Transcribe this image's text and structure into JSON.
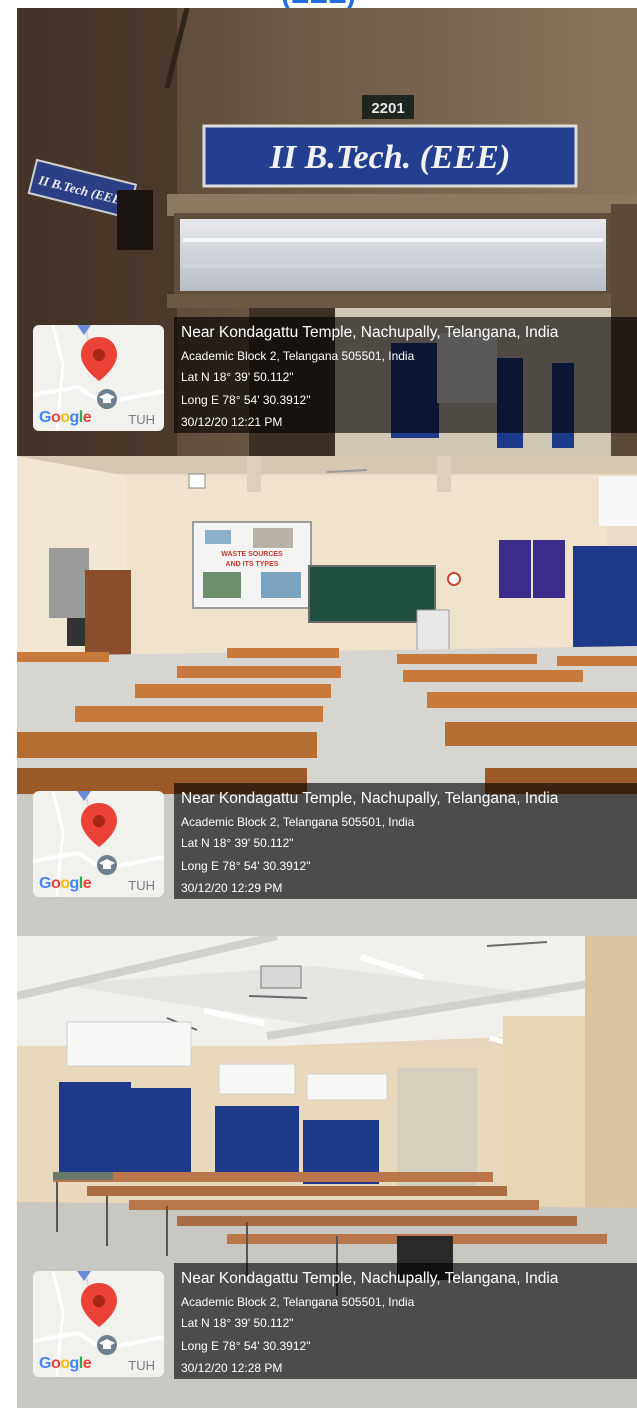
{
  "header": {
    "visible_text": "(EEE)"
  },
  "photos": [
    {
      "signs": {
        "room_number": "2201",
        "main_sign": "II B.Tech. (EEE)",
        "side_sign": "II B.Tech (EEE)"
      },
      "overlay": {
        "place": "Near Kondagattu Temple, Nachupally, Telangana, India",
        "address": "Academic Block 2, Telangana 505501, India",
        "lat": "Lat N 18° 39' 50.112\"",
        "long": "Long E 78° 54' 30.3912\"",
        "datetime": "30/12/20 12:21 PM"
      }
    },
    {
      "screen": {
        "line1": "WASTE SOURCES",
        "line2": "AND ITS TYPES"
      },
      "overlay": {
        "place": "Near Kondagattu Temple, Nachupally, Telangana, India",
        "address": "Academic Block 2, Telangana 505501, India",
        "lat": "Lat N 18° 39' 50.112\"",
        "long": "Long E 78° 54' 30.3912\"",
        "datetime": "30/12/20 12:29 PM"
      }
    },
    {
      "overlay": {
        "place": "Near Kondagattu Temple, Nachupally, Telangana, India",
        "address": "Academic Block 2, Telangana 505501, India",
        "lat": "Lat N 18° 39' 50.112\"",
        "long": "Long E 78° 54' 30.3912\"",
        "datetime": "30/12/20 12:28 PM"
      }
    }
  ],
  "map_badge": {
    "brand": "Google",
    "app_tag": "TUH"
  },
  "colors": {
    "header_text": "#1f6fe0",
    "pin_red": "#ea4335",
    "curtain_blue": "#1d3a8a",
    "sign_blue": "#243f8f"
  },
  "icons": [
    "map-pin-icon",
    "graduation-cap-icon"
  ]
}
